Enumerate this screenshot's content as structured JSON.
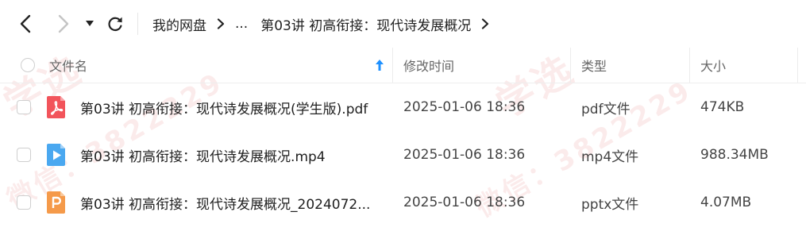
{
  "toolbar": {
    "back_icon": "chevron-left-icon",
    "forward_icon": "chevron-right-icon",
    "history_icon": "caret-down-icon",
    "refresh_icon": "refresh-icon"
  },
  "breadcrumb": {
    "root": "我的网盘",
    "ellipsis": "...",
    "current": "第03讲 初高衔接：现代诗发展概况"
  },
  "list": {
    "columns": {
      "name": "文件名",
      "modified": "修改时间",
      "type": "类型",
      "size": "大小"
    },
    "sort_icon": "arrow-up-icon",
    "rows": [
      {
        "icon": "pdf-file-icon",
        "name": "第03讲 初高衔接：现代诗发展概况(学生版).pdf",
        "modified": "2025-01-06 18:36",
        "type": "pdf文件",
        "size": "474KB"
      },
      {
        "icon": "video-file-icon",
        "name": "第03讲 初高衔接：现代诗发展概况.mp4",
        "modified": "2025-01-06 18:36",
        "type": "mp4文件",
        "size": "988.34MB"
      },
      {
        "icon": "pptx-file-icon",
        "name": "第03讲 初高衔接：现代诗发展概况_2024072...",
        "modified": "2025-01-06 18:36",
        "type": "pptx文件",
        "size": "4.07MB"
      }
    ]
  },
  "colors": {
    "accent_blue": "#1e90ff",
    "pdf_red": "#f2545b",
    "video_blue": "#4aa8f0",
    "pptx_orange": "#f59a4a"
  },
  "watermark": {
    "text_a": "学选",
    "text_b": "微信：3822229"
  }
}
